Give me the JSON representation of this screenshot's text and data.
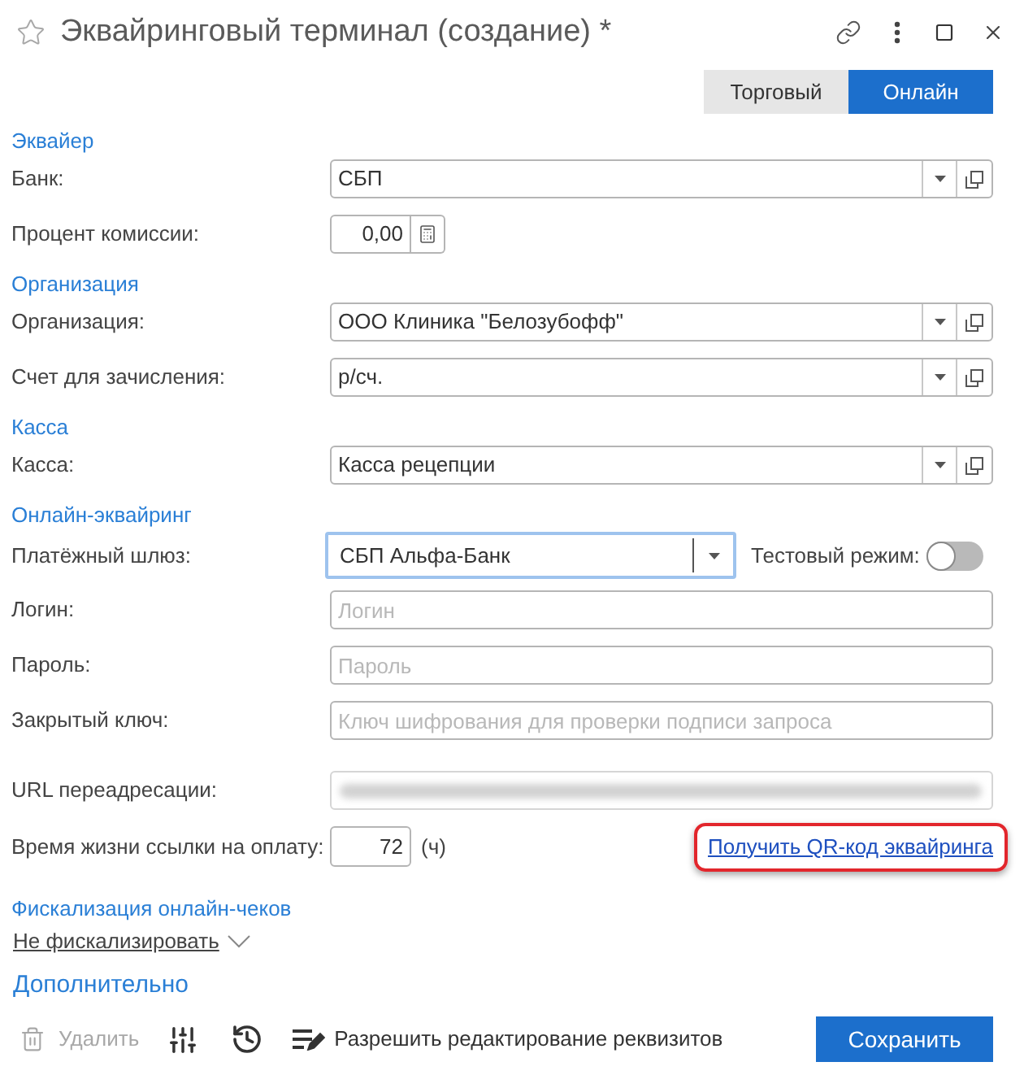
{
  "window": {
    "title": "Эквайринговый терминал (создание) *"
  },
  "mode_tabs": [
    {
      "label": "Торговый",
      "selected": false
    },
    {
      "label": "Онлайн",
      "selected": true
    }
  ],
  "sections": [
    {
      "title": "Эквайер",
      "fields": [
        {
          "kind": "select",
          "label": "Банк:",
          "value": "СБП"
        },
        {
          "kind": "number",
          "label": "Процент комиссии:",
          "value": "0,00"
        }
      ]
    },
    {
      "title": "Организация",
      "fields": [
        {
          "kind": "select",
          "label": "Организация:",
          "value": "ООО Клиника \"Белозубофф\""
        },
        {
          "kind": "select",
          "label": "Счет для зачисления:",
          "value": "р/сч."
        }
      ]
    },
    {
      "title": "Касса",
      "fields": [
        {
          "kind": "select",
          "label": "Касса:",
          "value": "Касса рецепции"
        }
      ]
    },
    {
      "title": "Онлайн-эквайринг",
      "fields": [
        {
          "kind": "gateway",
          "label": "Платёжный шлюз:",
          "value": "СБП Альфа-Банк",
          "focused": true,
          "toggle": {
            "label": "Тестовый режим:",
            "on": false
          }
        },
        {
          "kind": "text",
          "label": "Логин:",
          "placeholder": "Логин"
        },
        {
          "kind": "text",
          "label": "Пароль:",
          "placeholder": "Пароль"
        },
        {
          "kind": "text",
          "label": "Закрытый ключ:",
          "placeholder": "Ключ шифрования для проверки подписи запроса"
        },
        {
          "kind": "redacted",
          "label": "URL переадресации:"
        },
        {
          "kind": "lifetime",
          "label": "Время жизни ссылки на оплату:",
          "value": "72",
          "unit": "(ч)",
          "link": {
            "label": "Получить QR-код эквайринга",
            "highlighted": true
          }
        }
      ]
    },
    {
      "title": "Фискализация онлайн-чеков",
      "fields": [
        {
          "kind": "dropdown_link",
          "value": "Не фискализировать"
        }
      ]
    }
  ],
  "more_link": "Дополнительно",
  "toolbar": [
    {
      "kind": "delete",
      "label": "Удалить",
      "disabled": true
    },
    {
      "kind": "settings"
    },
    {
      "kind": "history"
    },
    {
      "kind": "edit",
      "label": "Разрешить редактирование реквизитов"
    }
  ],
  "save_button": "Сохранить"
}
